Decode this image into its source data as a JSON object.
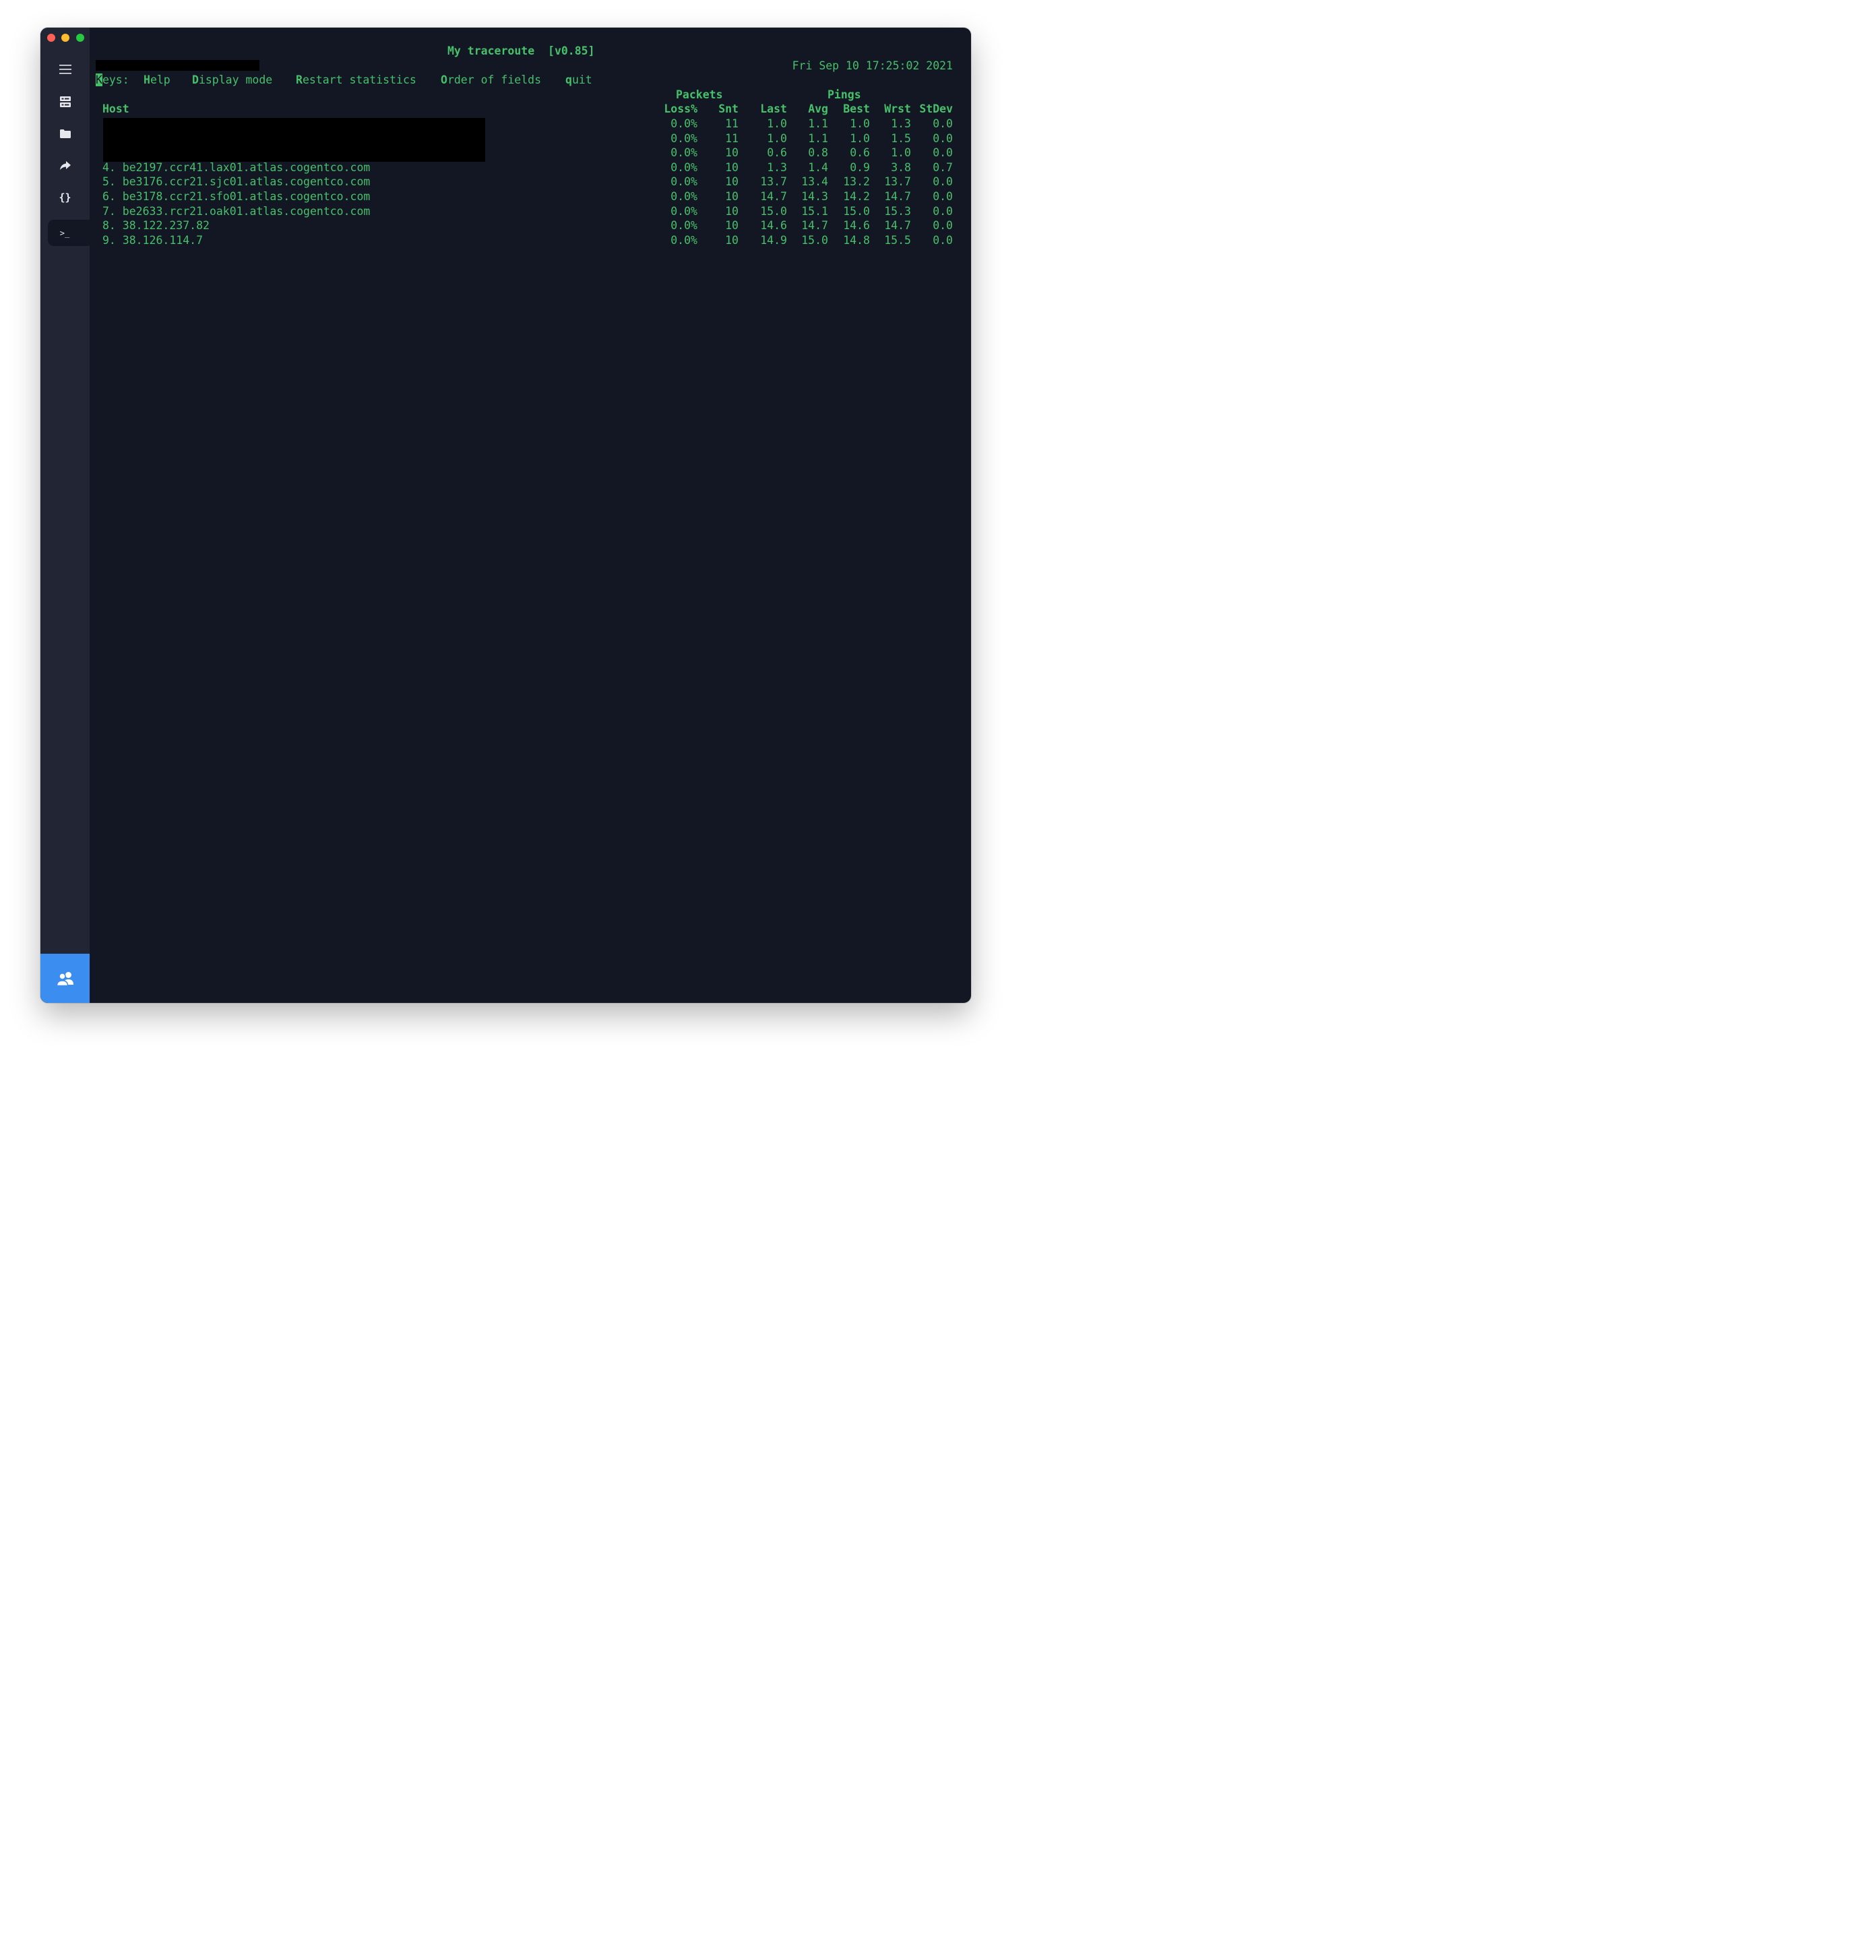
{
  "window": {
    "title": "My traceroute  [v0.85]",
    "datetime": "Fri Sep 10 17:25:02 2021"
  },
  "sidebar": {
    "items": [
      {
        "icon": "hamburger-menu-icon"
      },
      {
        "icon": "server-icon"
      },
      {
        "icon": "folder-icon"
      },
      {
        "icon": "forward-arrow-icon"
      },
      {
        "icon": "curly-braces-icon",
        "label": "{}"
      },
      {
        "icon": "terminal-icon",
        "label": ">_",
        "active": true
      }
    ],
    "bottom": {
      "icon": "users-icon"
    }
  },
  "keys": {
    "label": "Keys:",
    "help_key": "H",
    "help_rest": "elp",
    "display_key": "D",
    "display_rest": "isplay mode",
    "restart_key": "R",
    "restart_rest": "estart statistics",
    "order_key": "O",
    "order_rest": "rder of fields",
    "quit_key": "q",
    "quit_rest": "uit"
  },
  "table": {
    "group_packets": "Packets",
    "group_pings": "Pings",
    "headers": {
      "host": "Host",
      "loss": "Loss%",
      "snt": "Snt",
      "last": "Last",
      "avg": "Avg",
      "best": "Best",
      "wrst": "Wrst",
      "stdev": "StDev"
    },
    "rows": [
      {
        "host": "",
        "loss": "0.0%",
        "snt": "11",
        "last": "1.0",
        "avg": "1.1",
        "best": "1.0",
        "wrst": "1.3",
        "stdev": "0.0"
      },
      {
        "host": "",
        "loss": "0.0%",
        "snt": "11",
        "last": "1.0",
        "avg": "1.1",
        "best": "1.0",
        "wrst": "1.5",
        "stdev": "0.0"
      },
      {
        "host": "",
        "loss": "0.0%",
        "snt": "10",
        "last": "0.6",
        "avg": "0.8",
        "best": "0.6",
        "wrst": "1.0",
        "stdev": "0.0"
      },
      {
        "host": "4. be2197.ccr41.lax01.atlas.cogentco.com",
        "loss": "0.0%",
        "snt": "10",
        "last": "1.3",
        "avg": "1.4",
        "best": "0.9",
        "wrst": "3.8",
        "stdev": "0.7"
      },
      {
        "host": "5. be3176.ccr21.sjc01.atlas.cogentco.com",
        "loss": "0.0%",
        "snt": "10",
        "last": "13.7",
        "avg": "13.4",
        "best": "13.2",
        "wrst": "13.7",
        "stdev": "0.0"
      },
      {
        "host": "6. be3178.ccr21.sfo01.atlas.cogentco.com",
        "loss": "0.0%",
        "snt": "10",
        "last": "14.7",
        "avg": "14.3",
        "best": "14.2",
        "wrst": "14.7",
        "stdev": "0.0"
      },
      {
        "host": "7. be2633.rcr21.oak01.atlas.cogentco.com",
        "loss": "0.0%",
        "snt": "10",
        "last": "15.0",
        "avg": "15.1",
        "best": "15.0",
        "wrst": "15.3",
        "stdev": "0.0"
      },
      {
        "host": "8. 38.122.237.82",
        "loss": "0.0%",
        "snt": "10",
        "last": "14.6",
        "avg": "14.7",
        "best": "14.6",
        "wrst": "14.7",
        "stdev": "0.0"
      },
      {
        "host": "9. 38.126.114.7",
        "loss": "0.0%",
        "snt": "10",
        "last": "14.9",
        "avg": "15.0",
        "best": "14.8",
        "wrst": "15.5",
        "stdev": "0.0"
      }
    ]
  },
  "colors": {
    "terminal_bg": "#131724",
    "sidebar_bg": "#212534",
    "text_green": "#47c06a",
    "accent_blue": "#3b8ef0"
  }
}
